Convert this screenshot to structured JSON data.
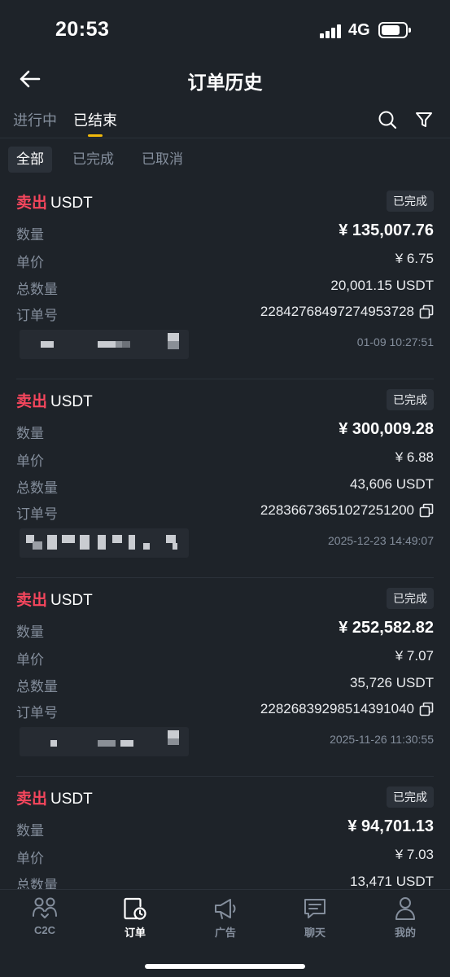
{
  "status_bar": {
    "time": "20:53",
    "network": "4G"
  },
  "nav": {
    "title": "订单历史"
  },
  "tabs": [
    {
      "label": "进行中",
      "active": false
    },
    {
      "label": "已结束",
      "active": true
    }
  ],
  "filters": [
    {
      "label": "全部",
      "active": true
    },
    {
      "label": "已完成",
      "active": false
    },
    {
      "label": "已取消",
      "active": false
    }
  ],
  "field_labels": {
    "amount": "数量",
    "price": "单价",
    "total_qty": "总数量",
    "order_no": "订单号"
  },
  "orders": [
    {
      "side": "卖出",
      "asset": "USDT",
      "status": "已完成",
      "amount": "¥ 135,007.76",
      "price": "¥ 6.75",
      "total_qty": "20,001.15 USDT",
      "order_no": "22842768497274953728",
      "time": "01-09 10:27:51"
    },
    {
      "side": "卖出",
      "asset": "USDT",
      "status": "已完成",
      "amount": "¥ 300,009.28",
      "price": "¥ 6.88",
      "total_qty": "43,606 USDT",
      "order_no": "22836673651027251200",
      "time": "2025-12-23 14:49:07"
    },
    {
      "side": "卖出",
      "asset": "USDT",
      "status": "已完成",
      "amount": "¥ 252,582.82",
      "price": "¥ 7.07",
      "total_qty": "35,726 USDT",
      "order_no": "22826839298514391040",
      "time": "2025-11-26 11:30:55"
    },
    {
      "side": "卖出",
      "asset": "USDT",
      "status": "已完成",
      "amount": "¥ 94,701.13",
      "price": "¥ 7.03",
      "total_qty": "13,471 USDT",
      "order_no": "",
      "time": ""
    }
  ],
  "bottom_nav": [
    {
      "label": "C2C",
      "icon": "c2c-users-icon",
      "active": false
    },
    {
      "label": "订单",
      "icon": "order-clock-icon",
      "active": true
    },
    {
      "label": "广告",
      "icon": "megaphone-icon",
      "active": false
    },
    {
      "label": "聊天",
      "icon": "chat-icon",
      "active": false
    },
    {
      "label": "我的",
      "icon": "profile-icon",
      "active": false
    }
  ],
  "colors": {
    "background": "#1e2329",
    "sell": "#f6465d",
    "accent": "#f0b90b",
    "muted": "#848e9c"
  }
}
